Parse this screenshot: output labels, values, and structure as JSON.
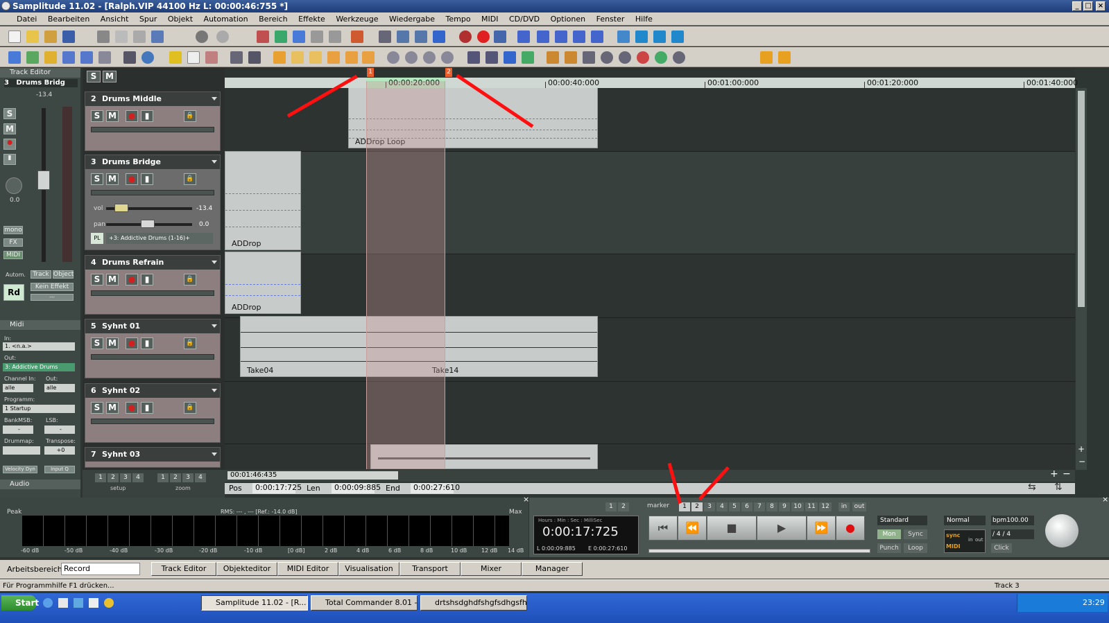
{
  "window": {
    "title": "Samplitude 11.02 - [Ralph.VIP   44100 Hz L: 00:00:46:755 *]",
    "min": "_",
    "max": "□",
    "close": "×"
  },
  "menu": [
    "Datei",
    "Bearbeiten",
    "Ansicht",
    "Spur",
    "Objekt",
    "Automation",
    "Bereich",
    "Effekte",
    "Werkzeuge",
    "Wiedergabe",
    "Tempo",
    "MIDI",
    "CD/DVD",
    "Optionen",
    "Fenster",
    "Hilfe"
  ],
  "left": {
    "panel_title": "Track Editor",
    "track_num": "3",
    "track_name": "Drums Bridg",
    "level": "-13.4",
    "pan": "0.0",
    "s": "S",
    "m": "M",
    "mono": "mono",
    "fx": "FX",
    "midi": "MIDI",
    "autom": "Autom.",
    "track": "Track",
    "object": "Object",
    "rd": "Rd",
    "kein_effekt": "Kein Effekt",
    "dashes": "---",
    "midi_section": "Midi",
    "in_label": "In:",
    "in_value": "1. <n.a.>",
    "out_label": "Out:",
    "out_value": "3: Addictive Drums",
    "channel_in_label": "Channel In:",
    "channel_out_label": "Out:",
    "channel_in": "alle",
    "channel_out": "alle",
    "programm_label": "Programm:",
    "programm": "1 Startup",
    "bankmsb_label": "BankMSB:",
    "lsb_label": "LSB:",
    "bankmsb": "-",
    "lsb": "-",
    "drummap_label": "Drummap:",
    "transpose_label": "Transpose:",
    "transpose": "+0",
    "velocity": "Velocity Dyn",
    "inputq": "Input Q",
    "audio_section": "Audio"
  },
  "tracks": [
    {
      "num": "2",
      "name": "Drums Middle"
    },
    {
      "num": "3",
      "name": "Drums Bridge",
      "vol_label": "vol",
      "vol": "-13.4",
      "pan_label": "pan",
      "pan": "0.0",
      "pl": "PL",
      "plugin": "+3: Addictive Drums (1-16)+"
    },
    {
      "num": "4",
      "name": "Drums Refrain"
    },
    {
      "num": "5",
      "name": "Syhnt 01"
    },
    {
      "num": "6",
      "name": "Syhnt 02"
    },
    {
      "num": "7",
      "name": "Syhnt 03"
    }
  ],
  "track_btns": {
    "s": "S",
    "m": "M",
    "rec": "●",
    "mute": "▮",
    "lock": "🔒"
  },
  "setup": {
    "label": "setup",
    "nums": [
      "1",
      "2",
      "3",
      "4"
    ]
  },
  "zoom": {
    "label": "zoom",
    "nums": [
      "1",
      "2",
      "3",
      "4"
    ]
  },
  "ruler": {
    "marks": [
      "00:00:20:000",
      "00:00:40:000",
      "00:01:00:000",
      "00:01:20:000",
      "00:01:40:000"
    ],
    "marker1": "1",
    "marker2": "2"
  },
  "clips": {
    "drums_middle": "ADDrop   Loop",
    "drums_bridge": "ADDrop",
    "drums_refrain": "ADDrop",
    "synth_a": "Take04",
    "synth_b": "Take14"
  },
  "scroll_time": "00:01:46:435",
  "position": {
    "pos_label": "Pos",
    "pos": "0:00:17:725",
    "len_label": "Len",
    "len": "0:00:09:885",
    "end_label": "End",
    "end": "0:00:27:610"
  },
  "meter": {
    "peak": "Peak",
    "rms": "RMS:  ---  ,  ---      [Ref.: -14.0 dB]",
    "max": "Max",
    "scale": [
      "-60 dB",
      "-50 dB",
      "-40 dB",
      "-30 dB",
      "-20 dB",
      "-10 dB",
      "[0 dB]",
      "2 dB",
      "4 dB",
      "6 dB",
      "8 dB",
      "10 dB",
      "12 dB",
      "14 dB"
    ]
  },
  "transport": {
    "marker_label": "marker",
    "marker_nums": [
      "1",
      "2",
      "3",
      "4",
      "5",
      "6",
      "7",
      "8",
      "9",
      "10",
      "11",
      "12"
    ],
    "left_nums": [
      "1",
      "2"
    ],
    "in": "in",
    "out": "out",
    "time_header": "Hours : Min : Sec : MilliSec",
    "time": "0:00:17:725",
    "l_time": "L 0:00:09:885",
    "e_time": "E  0:00:27:610",
    "standard": "Standard",
    "mon": "Mon",
    "sync": "Sync",
    "punch": "Punch",
    "loop": "Loop",
    "normal": "Normal",
    "bpm": "bpm100.00",
    "sig": "/   4 / 4",
    "sync_badge": "sync",
    "midi_badge": "MIDI",
    "in_small": "in",
    "out_small": "out",
    "click": "Click"
  },
  "workspace": {
    "label": "Arbeitsbereich:",
    "value": "Record",
    "buttons": [
      "Track Editor",
      "Objekteditor",
      "MIDI Editor",
      "Visualisation",
      "Transport",
      "Mixer",
      "Manager"
    ]
  },
  "status": {
    "left": "Für Programmhilfe F1 drücken...",
    "right": "Track 3"
  },
  "taskbar": {
    "start": "Start",
    "items": [
      "Samplitude 11.02 - [R...",
      "Total Commander 8.01 - ...",
      "drtshsdghdfshgfsdhgsfh..."
    ],
    "clock": "23:29"
  },
  "colors": {
    "accent_arrow": "#ff1010",
    "track_bg": "#8d7e80",
    "loop_selection": "#c89696"
  }
}
